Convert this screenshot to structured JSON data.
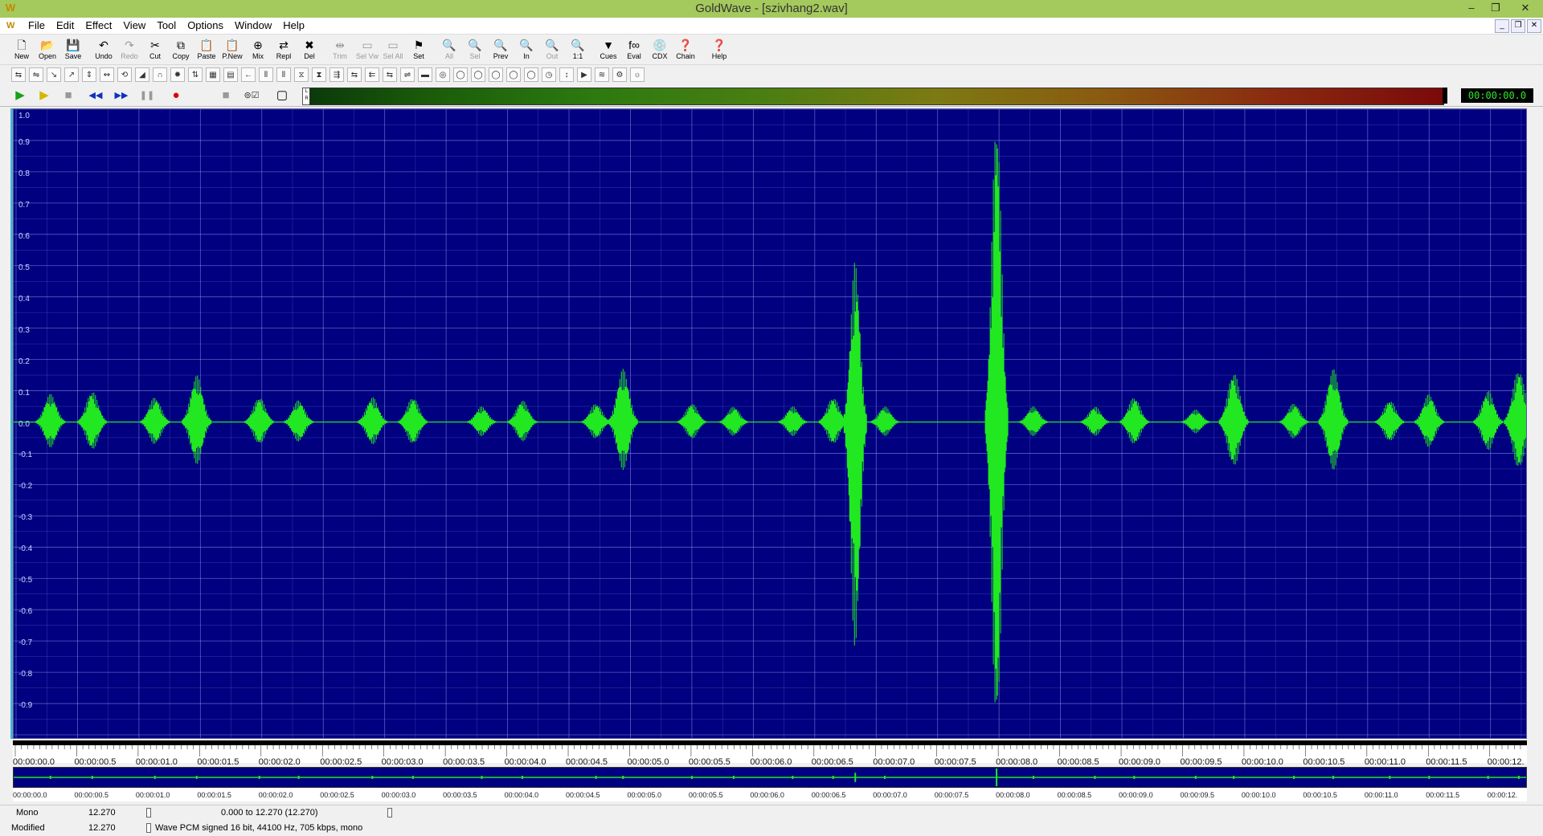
{
  "window": {
    "title": "GoldWave - [szivhang2.wav]"
  },
  "menu": [
    "File",
    "Edit",
    "Effect",
    "View",
    "Tool",
    "Options",
    "Window",
    "Help"
  ],
  "toolbar": [
    {
      "label": "New",
      "icon": "new-file-icon",
      "glyph": "🗋",
      "enabled": true
    },
    {
      "label": "Open",
      "icon": "open-folder-icon",
      "glyph": "📂",
      "enabled": true
    },
    {
      "label": "Save",
      "icon": "save-icon",
      "glyph": "💾",
      "enabled": true
    },
    {
      "label": "Undo",
      "icon": "undo-icon",
      "glyph": "↶",
      "enabled": true
    },
    {
      "label": "Redo",
      "icon": "redo-icon",
      "glyph": "↷",
      "enabled": false
    },
    {
      "label": "Cut",
      "icon": "scissors-icon",
      "glyph": "✂",
      "enabled": true
    },
    {
      "label": "Copy",
      "icon": "copy-icon",
      "glyph": "⧉",
      "enabled": true
    },
    {
      "label": "Paste",
      "icon": "paste-icon",
      "glyph": "📋",
      "enabled": true
    },
    {
      "label": "P.New",
      "icon": "paste-new-icon",
      "glyph": "📋",
      "enabled": true
    },
    {
      "label": "Mix",
      "icon": "mix-icon",
      "glyph": "⊕",
      "enabled": true
    },
    {
      "label": "Repl",
      "icon": "replace-icon",
      "glyph": "⇄",
      "enabled": true
    },
    {
      "label": "Del",
      "icon": "delete-icon",
      "glyph": "✖",
      "enabled": true
    },
    {
      "label": "Trim",
      "icon": "trim-icon",
      "glyph": "⇹",
      "enabled": false
    },
    {
      "label": "Sel Vw",
      "icon": "select-view-icon",
      "glyph": "▭",
      "enabled": false
    },
    {
      "label": "Sel All",
      "icon": "select-all-icon",
      "glyph": "▭",
      "enabled": false
    },
    {
      "label": "Set",
      "icon": "set-icon",
      "glyph": "⚑",
      "enabled": true
    },
    {
      "label": "All",
      "icon": "zoom-all-icon",
      "glyph": "🔍",
      "enabled": false
    },
    {
      "label": "Sel",
      "icon": "zoom-selection-icon",
      "glyph": "🔍",
      "enabled": false
    },
    {
      "label": "Prev",
      "icon": "zoom-previous-icon",
      "glyph": "🔍",
      "enabled": true
    },
    {
      "label": "In",
      "icon": "zoom-in-icon",
      "glyph": "🔍",
      "enabled": true
    },
    {
      "label": "Out",
      "icon": "zoom-out-icon",
      "glyph": "🔍",
      "enabled": false
    },
    {
      "label": "1:1",
      "icon": "zoom-actual-icon",
      "glyph": "🔍",
      "enabled": true
    },
    {
      "label": "Cues",
      "icon": "cues-icon",
      "glyph": "▼",
      "enabled": true
    },
    {
      "label": "Eval",
      "icon": "expression-evaluator-icon",
      "glyph": "f∞",
      "enabled": true
    },
    {
      "label": "CDX",
      "icon": "cd-extract-icon",
      "glyph": "💿",
      "enabled": true
    },
    {
      "label": "Chain",
      "icon": "chain-icon",
      "glyph": "❓",
      "enabled": true
    },
    {
      "label": "Help",
      "icon": "help-icon",
      "glyph": "❓",
      "enabled": true
    }
  ],
  "effects_toolbar_count": 36,
  "transport": {
    "buttons": [
      {
        "name": "play-all-button",
        "glyph": "▶",
        "color": "#18a018"
      },
      {
        "name": "play-selection-button",
        "glyph": "▶",
        "color": "#d7b600"
      },
      {
        "name": "stop-button",
        "glyph": "■",
        "color": "#999999"
      },
      {
        "name": "rewind-button",
        "glyph": "◀◀",
        "color": "#1030c0"
      },
      {
        "name": "fast-forward-button",
        "glyph": "▶▶",
        "color": "#1030c0"
      },
      {
        "name": "pause-button",
        "glyph": "❚❚",
        "color": "#999999"
      },
      {
        "name": "record-button",
        "glyph": "●",
        "color": "#e00000"
      },
      {
        "name": "stop-record-button",
        "glyph": "■",
        "color": "#999999"
      },
      {
        "name": "loop-button",
        "glyph": "⊚☑",
        "color": "#333333"
      },
      {
        "name": "record-mode-button",
        "glyph": "▢",
        "color": "#000000"
      }
    ],
    "level_meter_labels": "L R",
    "time_display": "00:00:00.0"
  },
  "waveform": {
    "background": "#000080",
    "grid_color": "#a0a8ff",
    "wave_color": "#21e821",
    "y_labels": [
      "1.0",
      "0.9",
      "0.8",
      "0.7",
      "0.6",
      "0.5",
      "0.4",
      "0.3",
      "0.2",
      "0.1",
      "0.0",
      "-0.1",
      "-0.2",
      "-0.3",
      "-0.4",
      "-0.5",
      "-0.6",
      "-0.7",
      "-0.8",
      "-0.9"
    ],
    "time_labels": [
      "00:00:00.0",
      "00:00:00.5",
      "00:00:01.0",
      "00:00:01.5",
      "00:00:02.0",
      "00:00:02.5",
      "00:00:03.0",
      "00:00:03.5",
      "00:00:04.0",
      "00:00:04.5",
      "00:00:05.0",
      "00:00:05.5",
      "00:00:06.0",
      "00:00:06.5",
      "00:00:07.0",
      "00:00:07.5",
      "00:00:08.0",
      "00:00:08.5",
      "00:00:09.0",
      "00:00:09.5",
      "00:00:10.0",
      "00:00:10.5",
      "00:00:11.0",
      "00:00:11.5",
      "00:00:12."
    ],
    "duration_s": 12.27,
    "bursts": [
      {
        "t": 0.28,
        "amp": 0.09
      },
      {
        "t": 0.62,
        "amp": 0.1
      },
      {
        "t": 1.13,
        "amp": 0.08
      },
      {
        "t": 1.47,
        "amp": 0.15
      },
      {
        "t": 1.98,
        "amp": 0.08
      },
      {
        "t": 2.3,
        "amp": 0.07
      },
      {
        "t": 2.9,
        "amp": 0.08
      },
      {
        "t": 3.23,
        "amp": 0.08
      },
      {
        "t": 3.79,
        "amp": 0.05
      },
      {
        "t": 4.12,
        "amp": 0.07
      },
      {
        "t": 4.72,
        "amp": 0.06
      },
      {
        "t": 4.94,
        "amp": 0.17
      },
      {
        "t": 5.5,
        "amp": 0.06
      },
      {
        "t": 5.84,
        "amp": 0.05
      },
      {
        "t": 6.32,
        "amp": 0.05
      },
      {
        "t": 6.65,
        "amp": 0.08
      },
      {
        "t": 6.83,
        "amp": 0.52,
        "neg": 0.73
      },
      {
        "t": 7.07,
        "amp": 0.05
      },
      {
        "t": 7.98,
        "amp": 1.0,
        "neg": 1.0
      },
      {
        "t": 8.28,
        "amp": 0.05
      },
      {
        "t": 8.78,
        "amp": 0.05
      },
      {
        "t": 9.1,
        "amp": 0.08
      },
      {
        "t": 9.6,
        "amp": 0.04
      },
      {
        "t": 9.91,
        "amp": 0.16
      },
      {
        "t": 10.4,
        "amp": 0.06
      },
      {
        "t": 10.72,
        "amp": 0.17
      },
      {
        "t": 11.18,
        "amp": 0.07
      },
      {
        "t": 11.5,
        "amp": 0.09
      },
      {
        "t": 11.98,
        "amp": 0.1
      },
      {
        "t": 12.23,
        "amp": 0.17
      }
    ]
  },
  "overview": {
    "time_labels": [
      "00:00:00.0",
      "00:00:00.5",
      "00:00:01.0",
      "00:00:01.5",
      "00:00:02.0",
      "00:00:02.5",
      "00:00:03.0",
      "00:00:03.5",
      "00:00:04.0",
      "00:00:04.5",
      "00:00:05.0",
      "00:00:05.5",
      "00:00:06.0",
      "00:00:06.5",
      "00:00:07.0",
      "00:00:07.5",
      "00:00:08.0",
      "00:00:08.5",
      "00:00:09.0",
      "00:00:09.5",
      "00:00:10.0",
      "00:00:10.5",
      "00:00:11.0",
      "00:00:11.5",
      "00:00:12."
    ]
  },
  "status": {
    "channels": "Mono",
    "length1": "12.270",
    "selection": "0.000 to 12.270 (12.270)",
    "state": "Modified",
    "length2": "12.270",
    "format": "Wave PCM signed 16 bit, 44100 Hz, 705 kbps, mono"
  }
}
